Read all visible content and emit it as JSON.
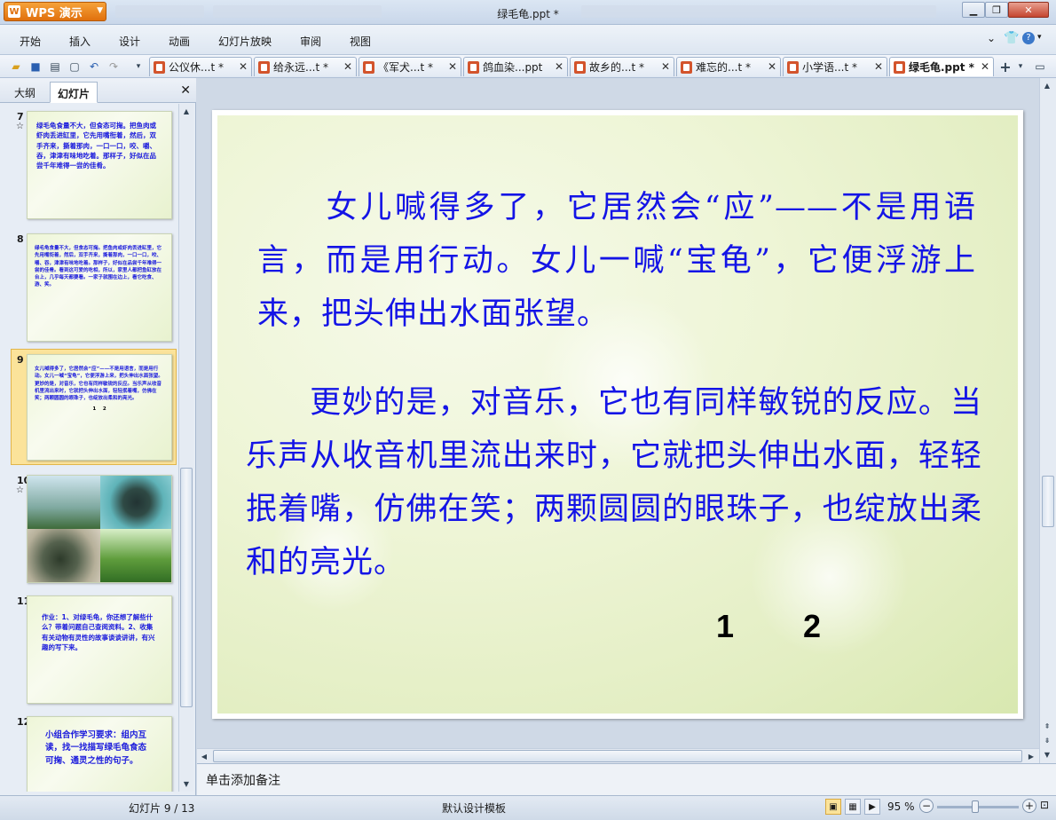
{
  "app": {
    "button_label": "WPS 演示",
    "window_title": "绿毛龟.ppt *"
  },
  "menu": [
    "开始",
    "插入",
    "设计",
    "动画",
    "幻灯片放映",
    "审阅",
    "视图"
  ],
  "tabs": [
    {
      "label": "公仪休...t *"
    },
    {
      "label": "给永远...t *"
    },
    {
      "label": "《军犬...t *"
    },
    {
      "label": "鸽血染...ppt"
    },
    {
      "label": "故乡的...t *"
    },
    {
      "label": "难忘的...t *"
    },
    {
      "label": "小学语...t *"
    },
    {
      "label": "绿毛龟.ppt *"
    }
  ],
  "sidebar": {
    "tab_outline": "大纲",
    "tab_slides": "幻灯片",
    "thumbnails": [
      {
        "num": "7",
        "star": "☆",
        "text": "绿毛龟食量不大，但食态可掬。把鱼肉或虾肉丢进缸里，它先用嘴衔着，然后，双手齐来，撕着那肉，一口一口，咬、嚼、吞，津津有味地吃着。那样子，好似在品尝千年难得一尝的佳肴。"
      },
      {
        "num": "8",
        "star": "",
        "text": "绿毛龟食量不大，但食态可掬。把鱼肉或虾肉丢进缸里，它先用嘴衔着，然后，双手齐来，撕着那肉，一口一口，咬、嚼、吞，津津有味地吃着。那样子，好似在品尝千年难得一尝的佳肴。看到这可爱的吃相，所以，家里人都把鱼缸放在台上，几乎每天都要看。一家子就围在边上，看它吃食、游、笑。"
      },
      {
        "num": "9",
        "star": "",
        "text": "女儿喊得多了，它居然会“应”——不是用语言，而是用行动。女儿一喊“宝龟”，它便浮游上来，把头伸出水面张望。更妙的是，对音乐，它也有同样敏锐的反应。当乐声从收音机里流出来时，它就把头伸出水面，轻轻抿着嘴，仿佛在笑；两颗圆圆的眼珠子，也绽放出柔和的亮光。",
        "pages": "1    2"
      },
      {
        "num": "10",
        "star": "☆",
        "text": ""
      },
      {
        "num": "11",
        "star": "",
        "text": "作业：1、对绿毛龟，你还想了解些什么？带着问题自己查阅资料。2、收集有关动物有灵性的故事谈谈讲讲，有兴趣的写下来。"
      },
      {
        "num": "12",
        "star": "",
        "text": "小组合作学习要求：组内互读，找一找描写绿毛龟食态可掬、通灵之性的句子。"
      }
    ]
  },
  "slide": {
    "paragraph1": "　　女儿喊得多了，它居然会“应”——不是用语言，而是用行动。女儿一喊“宝龟”，它便浮游上来，把头伸出水面张望。",
    "paragraph2": "　　更妙的是，对音乐，它也有同样敏锐的反应。当乐声从收音机里流出来时，它就把头伸出水面，轻轻抿着嘴，仿佛在笑；两颗圆圆的眼珠子，也绽放出柔和的亮光。",
    "page_a": "1",
    "page_b": "2"
  },
  "notes_placeholder": "单击添加备注",
  "status": {
    "slide_counter": "幻灯片 9 / 13",
    "template": "默认设计模板",
    "zoom": "95 %"
  },
  "colors": {
    "slide_text": "#1414e6",
    "accent": "#e0700c"
  }
}
